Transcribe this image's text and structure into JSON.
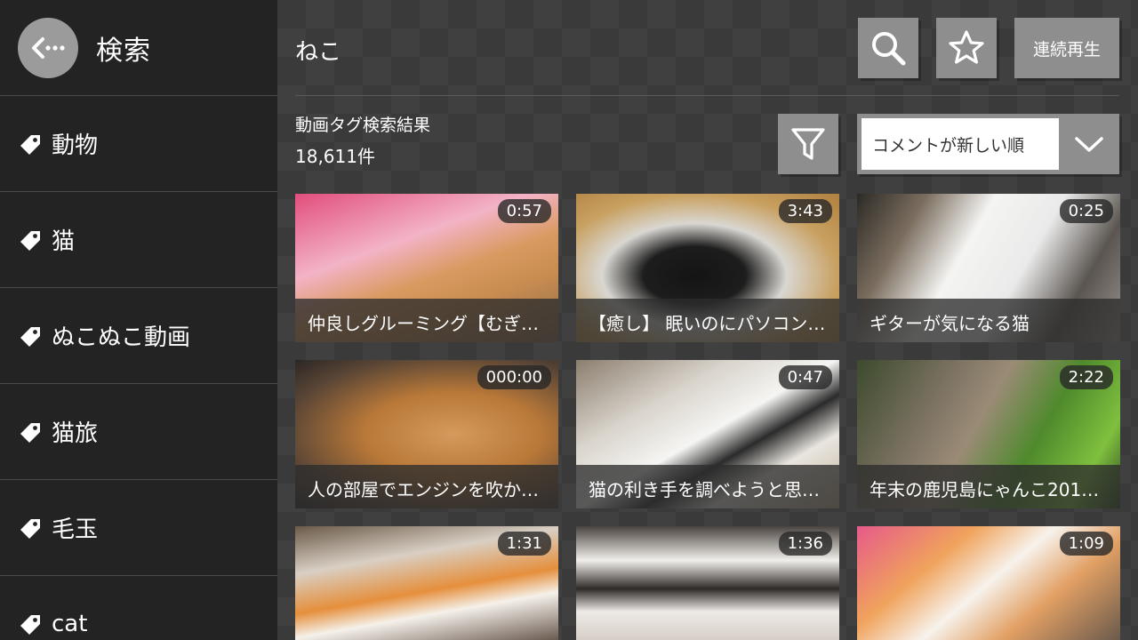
{
  "sidebar": {
    "title": "検索",
    "tags": [
      {
        "label": "動物"
      },
      {
        "label": "猫"
      },
      {
        "label": "ぬこぬこ動画"
      },
      {
        "label": "猫旅"
      },
      {
        "label": "毛玉"
      },
      {
        "label": "cat"
      }
    ]
  },
  "header": {
    "query": "ねこ",
    "continuous_play_label": "連続再生"
  },
  "results": {
    "title": "動画タグ検索結果",
    "count": "18,611件",
    "sort_selected": "コメントが新しい順"
  },
  "videos": [
    {
      "title": "仲良しグルーミング【むぎ…",
      "duration": "0:57"
    },
    {
      "title": "【癒し】 眠いのにパソコン…",
      "duration": "3:43"
    },
    {
      "title": "ギターが気になる猫",
      "duration": "0:25"
    },
    {
      "title": "人の部屋でエンジンを吹か…",
      "duration": "000:00"
    },
    {
      "title": "猫の利き手を調べようと思…",
      "duration": "0:47"
    },
    {
      "title": "年末の鹿児島にゃんこ201…",
      "duration": "2:22"
    },
    {
      "title": "",
      "duration": "1:31"
    },
    {
      "title": "",
      "duration": "1:36"
    },
    {
      "title": "",
      "duration": "1:09"
    }
  ],
  "colors": {
    "sidebar_bg": "#232323",
    "button_bg": "#8e8e8e",
    "back_button_bg": "#9b9b9b"
  }
}
